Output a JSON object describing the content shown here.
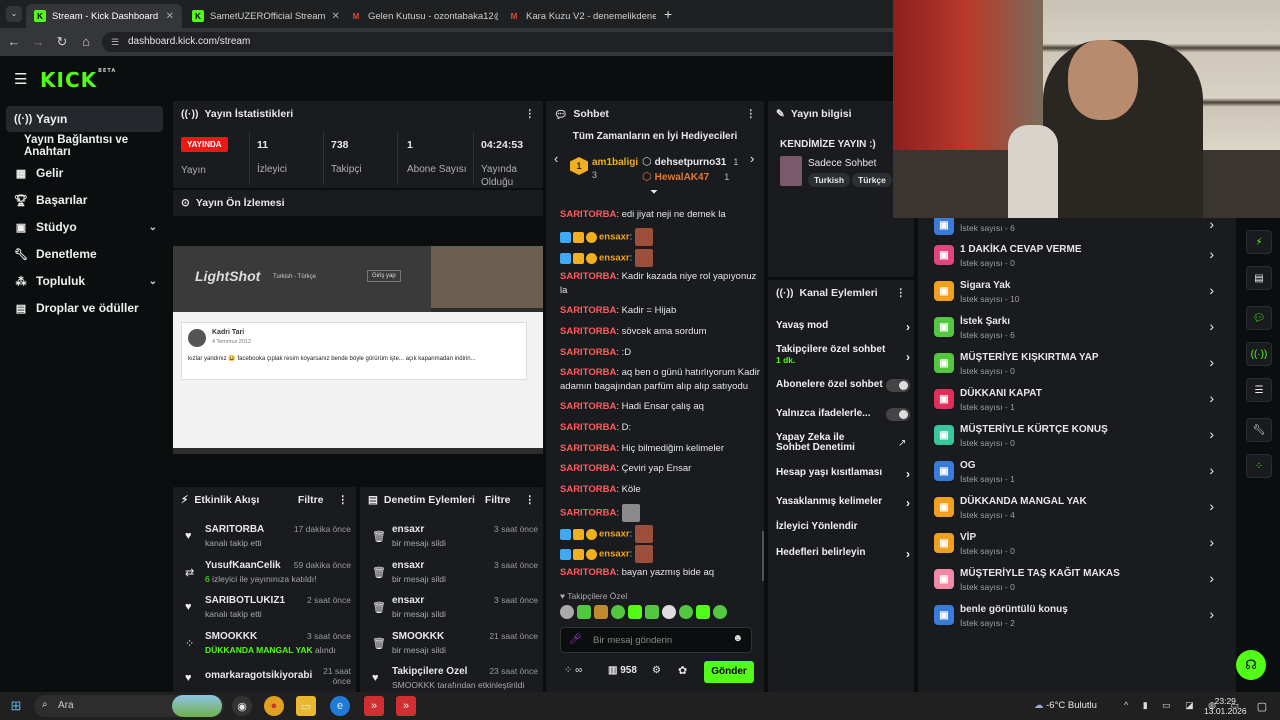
{
  "browser": {
    "tabs": [
      {
        "title": "Stream - Kick Dashboard",
        "color": "#53fc18",
        "active": true
      },
      {
        "title": "SametUZEROfficial Stream",
        "color": "#53fc18",
        "active": false
      },
      {
        "title": "Gelen Kutusu - ozontabaka12@",
        "color": "#ea4335",
        "active": false
      },
      {
        "title": "Kara Kuzu V2 - denemelikdene",
        "color": "#ea4335",
        "active": false
      }
    ],
    "url": "dashboard.kick.com/stream"
  },
  "kick": {
    "logo": "KICK",
    "beta": "BETA"
  },
  "sidebar": {
    "items": [
      {
        "label": "Yayın",
        "icon": "broadcast-icon"
      },
      {
        "label": "Yayın Bağlantısı ve Anahtarı",
        "icon": ""
      },
      {
        "label": "Gelir",
        "icon": "revenue-icon"
      },
      {
        "label": "Başarılar",
        "icon": "trophy-icon"
      },
      {
        "label": "Stüdyo",
        "icon": "studio-icon"
      },
      {
        "label": "Denetleme",
        "icon": "wrench-icon"
      },
      {
        "label": "Topluluk",
        "icon": "community-icon"
      },
      {
        "label": "Droplar ve ödüller",
        "icon": "gift-icon"
      }
    ]
  },
  "stats": {
    "title": "Yayın İstatistikleri",
    "live": "YAYINDA",
    "status_label": "Yayın",
    "viewers": "11",
    "viewers_label": "İzleyici",
    "followers": "738",
    "followers_label": "Takipçi",
    "subs": "1",
    "subs_label": "Abone Sayısı",
    "uptime": "04:24:53",
    "uptime_label": "Yayında Olduğu"
  },
  "preview": {
    "title": "Yayın Ön İzlemesi",
    "lightshot": "LightShot",
    "lang": "Turkish - Türkçe",
    "login": "Giriş yap",
    "post_author": "Kadri Tari",
    "post_date": "4 Temmuz 2012",
    "post_text": "kızlar yandınız 😀 facebooka çıplak resim koyarsanız bende böyle görürüm işte... açık kapanmadan indirin..."
  },
  "activity": {
    "title": "Etkinlik Akışı",
    "filter": "Filtre",
    "rows": [
      {
        "name": "SARITORBA",
        "sub": "kanalı takip etti",
        "time": "17 dakika önce",
        "icon": "heart-icon"
      },
      {
        "name": "YusufKaanCelik",
        "sub_hl": "6",
        "sub": " izleyici ile yayınınıza katıldı!",
        "time": "59 dakika önce",
        "icon": "raid-icon"
      },
      {
        "name": "SARIBOTLUKIZ1",
        "sub": "kanalı takip etti",
        "time": "2 saat önce",
        "icon": "heart-icon"
      },
      {
        "name": "SMOOKKK",
        "sub_hl": "DÜKKANDA MANGAL YAK",
        "sub": " alındı",
        "time": "3 saat önce",
        "icon": "reward-icon"
      },
      {
        "name": "omarkaragotsikiyorabi",
        "sub": "",
        "time": "21 saat önce",
        "icon": "heart-icon"
      }
    ]
  },
  "moderation": {
    "title": "Denetim Eylemleri",
    "filter": "Filtre",
    "rows": [
      {
        "name": "ensaxr",
        "sub": "bir mesajı sildi",
        "time": "3 saat önce"
      },
      {
        "name": "ensaxr",
        "sub": "bir mesajı sildi",
        "time": "3 saat önce"
      },
      {
        "name": "ensaxr",
        "sub": "bir mesajı sildi",
        "time": "3 saat önce"
      },
      {
        "name": "SMOOKKK",
        "sub": "bir mesajı sildi",
        "time": "21 saat önce"
      },
      {
        "name": "Takipçilere Özel",
        "sub": "SMOOKKK tarafından etkinleştirildi",
        "time": "23 saat önce"
      }
    ]
  },
  "chat": {
    "title": "Sohbet",
    "gifters_title": "Tüm Zamanların en İyi Hediyecileri",
    "gifters": [
      {
        "rank": "1",
        "name": "am1baligi",
        "count": "3"
      },
      {
        "rank": "2",
        "name": "dehsetpurno31",
        "count": "1"
      },
      {
        "rank": "3",
        "name": "HewalAK47",
        "count": "1"
      }
    ],
    "messages": [
      {
        "user": "SARITORBA",
        "text": "edi jiyat neji ne demek la"
      },
      {
        "user": "ensaxr",
        "text": ""
      },
      {
        "user": "ensaxr",
        "text": ""
      },
      {
        "user": "SARITORBA",
        "text": "Kadir kazada niye rol yapıyonuz la"
      },
      {
        "user": "SARITORBA",
        "text": "Kadir = Hijab"
      },
      {
        "user": "SARITORBA",
        "text": "sövcek ama sordum"
      },
      {
        "user": "SARITORBA",
        "text": ":D"
      },
      {
        "user": "SARITORBA",
        "text": "aq ben o günü hatırlıyorum Kadir adamın bagajından parfüm alıp alıp satıyodu"
      },
      {
        "user": "SARITORBA",
        "text": "Hadi Ensar çalış aq"
      },
      {
        "user": "SARITORBA",
        "text": "D:"
      },
      {
        "user": "SARITORBA",
        "text": "Hiç bilmediğim kelimeler"
      },
      {
        "user": "SARITORBA",
        "text": "Çeviri yap Ensar"
      },
      {
        "user": "SARITORBA",
        "text": "Köle"
      },
      {
        "user": "SARITORBA",
        "text": ""
      },
      {
        "user": "ensaxr",
        "text": ""
      },
      {
        "user": "ensaxr",
        "text": ""
      },
      {
        "user": "SARITORBA",
        "text": "bayan yazmış bide aq"
      }
    ],
    "followers_only": "Takipçilere Özel",
    "placeholder": "Bir mesaj gönderin",
    "viewer_count": "958",
    "send": "Gönder"
  },
  "streaminfo": {
    "title": "Yayın bilgisi",
    "stream_title": "KENDİMİZE YAYIN :)",
    "category": "Sadece Sohbet",
    "tags": [
      "Turkish",
      "Türkçe"
    ]
  },
  "channel_actions": {
    "title": "Kanal Eylemleri",
    "items": [
      {
        "label": "Yavaş mod",
        "type": "arrow"
      },
      {
        "label": "Takipçilere özel sohbet",
        "sub": "1 dk.",
        "type": "arrow"
      },
      {
        "label": "Abonelere özel sohbet",
        "type": "toggle"
      },
      {
        "label": "Yalnızca ifadelerle...",
        "type": "toggle"
      },
      {
        "label": "Yapay Zeka ile Sohbet Denetimi",
        "type": "ext"
      },
      {
        "label": "Hesap yaşı kısıtlaması",
        "type": "arrow"
      },
      {
        "label": "Yasaklanmış kelimeler",
        "type": "arrow"
      },
      {
        "label": "İzleyici Yönlendir",
        "type": "none"
      },
      {
        "label": "Hedefleri belirleyin",
        "type": "arrow"
      }
    ]
  },
  "rewards": [
    {
      "title": "",
      "count": "İstek sayısı - 6",
      "color": "#3b7bd8"
    },
    {
      "title": "1 DAKİKA CEVAP VERME",
      "count": "İstek sayısı - 0",
      "color": "#e0457b"
    },
    {
      "title": "Sigara Yak",
      "count": "İstek sayısı - 10",
      "color": "#f0a020"
    },
    {
      "title": "İstek Şarkı",
      "count": "İstek sayısı - 6",
      "color": "#53c740"
    },
    {
      "title": "MÜŞTERİYE KIŞKIRTMA YAP",
      "count": "İstek sayısı - 0",
      "color": "#53c740"
    },
    {
      "title": "DÜKKANI KAPAT",
      "count": "İstek sayısı - 1",
      "color": "#e0305a"
    },
    {
      "title": "MÜŞTERİYLE KÜRTÇE KONUŞ",
      "count": "İstek sayısı - 0",
      "color": "#3ac7a0"
    },
    {
      "title": "OG",
      "count": "İstek sayısı - 1",
      "color": "#3b7bd8"
    },
    {
      "title": "DÜKKANDA MANGAL YAK",
      "count": "İstek sayısı - 4",
      "color": "#f0a020"
    },
    {
      "title": "VİP",
      "count": "İstek sayısı - 0",
      "color": "#f0a020"
    },
    {
      "title": "MÜŞTERİYLE TAŞ KAĞIT MAKAS",
      "count": "İstek sayısı - 0",
      "color": "#f08aa8"
    },
    {
      "title": "benle görüntülü konuş",
      "count": "İstek sayısı - 2",
      "color": "#3b7bd8"
    }
  ],
  "taskbar": {
    "search": "Ara",
    "weather": "-6°C Bulutlu",
    "time": "23:29",
    "date": "13.01.2026"
  }
}
